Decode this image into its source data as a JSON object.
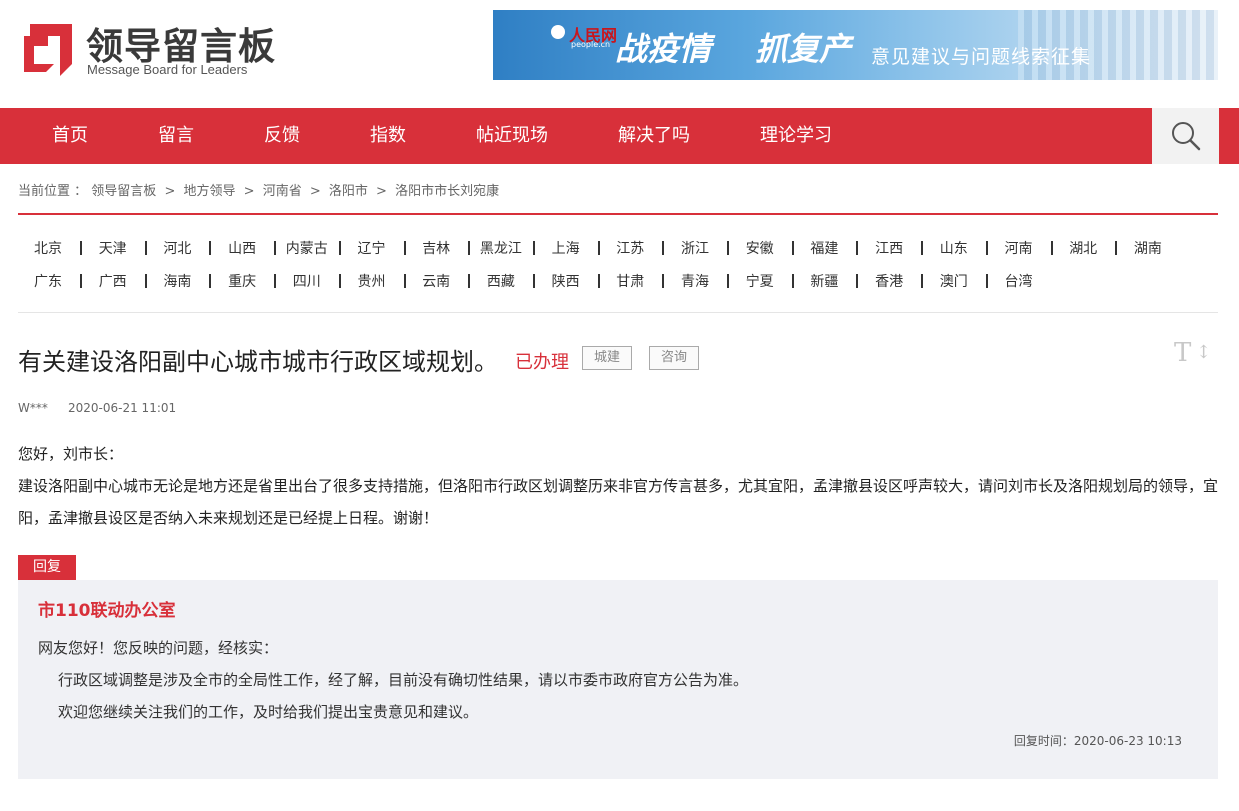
{
  "header": {
    "logo_title": "领导留言板",
    "logo_subtitle": "Message Board for Leaders",
    "brand_color": "#d8303a"
  },
  "banner": {
    "brand": "人民网",
    "brand_sub": "people.cn",
    "headline_1": "战疫情",
    "headline_2": "抓复产",
    "headline_3": "意见建议与问题线索征集"
  },
  "nav": {
    "items": [
      "首页",
      "留言",
      "反馈",
      "指数",
      "帖近现场",
      "解决了吗",
      "理论学习"
    ],
    "search_icon": "search-icon"
  },
  "breadcrumb": {
    "prefix": "当前位置 ：",
    "items": [
      "领导留言板",
      "地方领导",
      "河南省",
      "洛阳市",
      "洛阳市市长刘宛康"
    ],
    "separator": ">"
  },
  "provinces": {
    "row1": [
      "北京",
      "天津",
      "河北",
      "山西",
      "内蒙古",
      "辽宁",
      "吉林",
      "黑龙江",
      "上海",
      "江苏",
      "浙江",
      "安徽",
      "福建",
      "江西",
      "山东",
      "河南",
      "湖北",
      "湖南"
    ],
    "row2": [
      "广东",
      "广西",
      "海南",
      "重庆",
      "四川",
      "贵州",
      "云南",
      "西藏",
      "陕西",
      "甘肃",
      "青海",
      "宁夏",
      "新疆",
      "香港",
      "澳门",
      "台湾"
    ]
  },
  "message": {
    "title": "有关建设洛阳副中心城市城市行政区域规划。",
    "status": "已办理",
    "tags": [
      "城建",
      "咨询"
    ],
    "font_toggle_icon": "text-size-icon",
    "author": "W***",
    "date": "2020-06-21 11:01",
    "greeting": "您好，刘市长：",
    "content": "建设洛阳副中心城市无论是地方还是省里出台了很多支持措施，但洛阳市行政区划调整历来非官方传言甚多，尤其宜阳，孟津撤县设区呼声较大，请问刘市长及洛阳规划局的领导，宜阳，孟津撤县设区是否纳入未来规划还是已经提上日程。谢谢！"
  },
  "reply": {
    "tag": "回复",
    "org": "市110联动办公室",
    "greeting": "网友您好！您反映的问题，经核实：",
    "paragraphs": [
      "行政区域调整是涉及全市的全局性工作，经了解，目前没有确切性结果，请以市委市政府官方公告为准。",
      "欢迎您继续关注我们的工作，及时给我们提出宝贵意见和建议。"
    ],
    "time_label": "回复时间：",
    "time": "2020-06-23 10:13"
  }
}
